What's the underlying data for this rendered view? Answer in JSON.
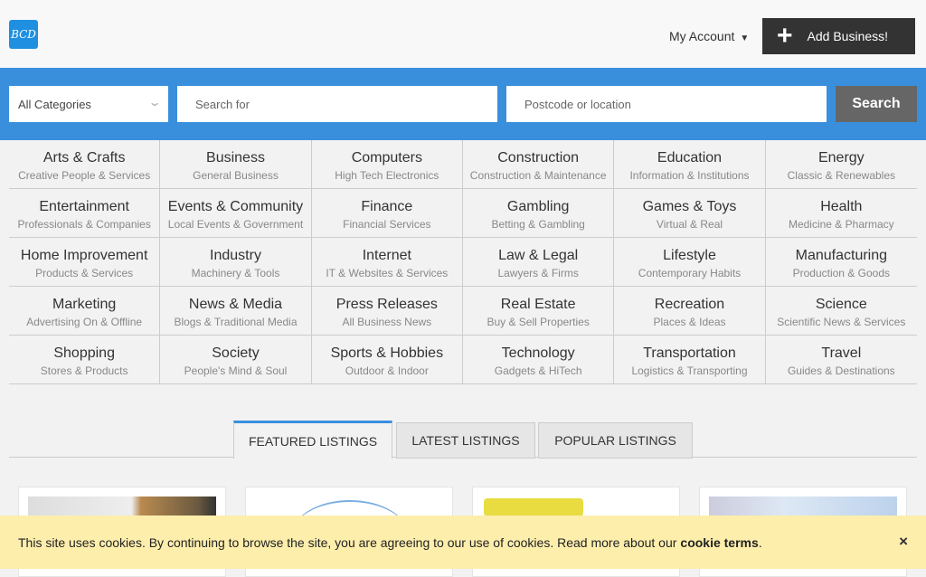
{
  "header": {
    "logo": "BCD",
    "account": "My Account",
    "account_arrow": "▼",
    "add_business": "Add Business!",
    "plus": "+"
  },
  "search": {
    "category": "All Categories",
    "search_placeholder": "Search for",
    "location_placeholder": "Postcode or location",
    "button": "Search"
  },
  "categories": [
    {
      "title": "Arts & Crafts",
      "sub": "Creative People & Services"
    },
    {
      "title": "Business",
      "sub": "General Business"
    },
    {
      "title": "Computers",
      "sub": "High Tech Electronics"
    },
    {
      "title": "Construction",
      "sub": "Construction & Maintenance"
    },
    {
      "title": "Education",
      "sub": "Information & Institutions"
    },
    {
      "title": "Energy",
      "sub": "Classic & Renewables"
    },
    {
      "title": "Entertainment",
      "sub": "Professionals & Companies"
    },
    {
      "title": "Events & Community",
      "sub": "Local Events & Government"
    },
    {
      "title": "Finance",
      "sub": "Financial Services"
    },
    {
      "title": "Gambling",
      "sub": "Betting & Gambling"
    },
    {
      "title": "Games & Toys",
      "sub": "Virtual & Real"
    },
    {
      "title": "Health",
      "sub": "Medicine & Pharmacy"
    },
    {
      "title": "Home Improvement",
      "sub": "Products & Services"
    },
    {
      "title": "Industry",
      "sub": "Machinery & Tools"
    },
    {
      "title": "Internet",
      "sub": "IT & Websites & Services"
    },
    {
      "title": "Law & Legal",
      "sub": "Lawyers & Firms"
    },
    {
      "title": "Lifestyle",
      "sub": "Contemporary Habits"
    },
    {
      "title": "Manufacturing",
      "sub": "Production & Goods"
    },
    {
      "title": "Marketing",
      "sub": "Advertising On & Offline"
    },
    {
      "title": "News & Media",
      "sub": "Blogs & Traditional Media"
    },
    {
      "title": "Press Releases",
      "sub": "All Business News"
    },
    {
      "title": "Real Estate",
      "sub": "Buy & Sell Properties"
    },
    {
      "title": "Recreation",
      "sub": "Places & Ideas"
    },
    {
      "title": "Science",
      "sub": "Scientific News & Services"
    },
    {
      "title": "Shopping",
      "sub": "Stores & Products"
    },
    {
      "title": "Society",
      "sub": "People's Mind & Soul"
    },
    {
      "title": "Sports & Hobbies",
      "sub": "Outdoor & Indoor"
    },
    {
      "title": "Technology",
      "sub": "Gadgets & HiTech"
    },
    {
      "title": "Transportation",
      "sub": "Logistics & Transporting"
    },
    {
      "title": "Travel",
      "sub": "Guides & Destinations"
    }
  ],
  "tabs": [
    "FEATURED LISTINGS",
    "LATEST LISTINGS",
    "POPULAR LISTINGS"
  ],
  "cookie": {
    "text": "This site uses cookies. By continuing to browse the site, you are agreeing to our use of cookies. Read more about our",
    "link": "cookie terms",
    "period": ".",
    "close": "×"
  }
}
